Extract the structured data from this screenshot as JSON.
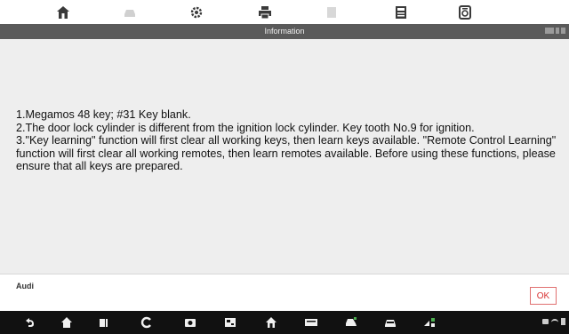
{
  "toolbar": {
    "icons": [
      "home-icon",
      "vehicle-icon",
      "settings-icon",
      "print-icon",
      "help-icon",
      "save-icon",
      "data-logging-icon"
    ]
  },
  "titlebar": {
    "title": "Information"
  },
  "content": {
    "lines": [
      "1.Megamos 48 key; #31 Key blank.",
      "2.The door lock cylinder is different from the ignition lock cylinder. Key tooth No.9 for ignition.",
      "3.\"Key learning\" function will first clear all working keys, then learn keys available. \"Remote Control Learning\" function will first clear all working remotes, then learn remotes available. Before using these functions, please ensure that all keys are prepared."
    ]
  },
  "footer": {
    "brand": "Audi",
    "ok_label": "OK"
  },
  "navbar": {
    "icons": [
      "back-icon",
      "home-icon",
      "recent-apps-icon",
      "browser-icon",
      "screenshot-icon",
      "vci-icon",
      "maxisys-home-icon",
      "vci-status-icon",
      "car-icon",
      "shop-icon",
      "network-icon"
    ],
    "status_icons": [
      "message-icon",
      "wifi-icon",
      "battery-icon"
    ]
  },
  "colors": {
    "titlebar": "#5a5a5a",
    "content_bg": "#eeeeee",
    "navbar": "#111111",
    "ok_text": "#d83232"
  }
}
